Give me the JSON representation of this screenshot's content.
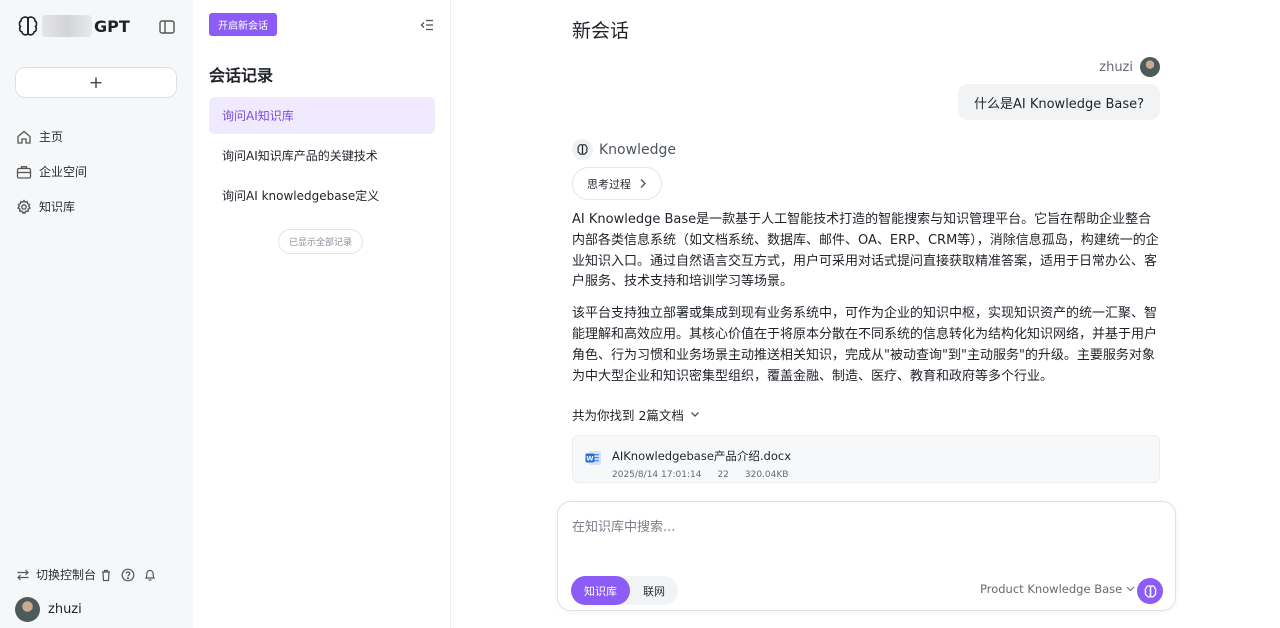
{
  "colors": {
    "accent": "#8b5cf6",
    "active_bg": "#f0eafe",
    "sidebar_bg": "#f6f7f9"
  },
  "sidebar": {
    "brand": "GPT",
    "new_button_icon": "+",
    "nav": [
      {
        "label": "主页",
        "icon": "home-icon"
      },
      {
        "label": "企业空间",
        "icon": "briefcase-icon"
      },
      {
        "label": "知识库",
        "icon": "gear-icon"
      }
    ],
    "switch_console": "切换控制台",
    "user_name": "zhuzi"
  },
  "history": {
    "new_chat": "开启新会话",
    "title": "会话记录",
    "items": [
      {
        "label": "询问AI知识库"
      },
      {
        "label": "询问AI知识库产品的关键技术"
      },
      {
        "label": "询问AI knowledgebase定义"
      }
    ],
    "all_shown": "已显示全部记录"
  },
  "main": {
    "title": "新会话",
    "user_name": "zhuzi",
    "user_message": "什么是AI Knowledge Base?",
    "bot_name": "Knowledge",
    "thinking_label": "思考过程",
    "answer_p1": "AI Knowledge Base是一款基于人工智能技术打造的智能搜索与知识管理平台。它旨在帮助企业整合内部各类信息系统（如文档系统、数据库、邮件、OA、ERP、CRM等），消除信息孤岛，构建统一的企业知识入口。通过自然语言交互方式，用户可采用对话式提问直接获取精准答案，适用于日常办公、客户服务、技术支持和培训学习等场景。",
    "answer_p2": "该平台支持独立部署或集成到现有业务系统中，可作为企业的知识中枢，实现知识资产的统一汇聚、智能理解和高效应用。其核心价值在于将原本分散在不同系统的信息转化为结构化知识网络，并基于用户角色、行为习惯和业务场景主动推送相关知识，完成从\"被动查询\"到\"主动服务\"的升级。主要服务对象为中大型企业和知识密集型组织，覆盖金融、制造、医疗、教育和政府等多个行业。",
    "found_docs": "共为你找到 2篇文档",
    "doc": {
      "name": "AIKnowledgebase产品介绍.docx",
      "date": "2025/8/14 17:01:14",
      "count": "22",
      "size": "320.04KB"
    }
  },
  "input": {
    "placeholder": "在知识库中搜索...",
    "mode_kb": "知识库",
    "mode_web": "联网",
    "kb_select": "Product Knowledge Base"
  }
}
